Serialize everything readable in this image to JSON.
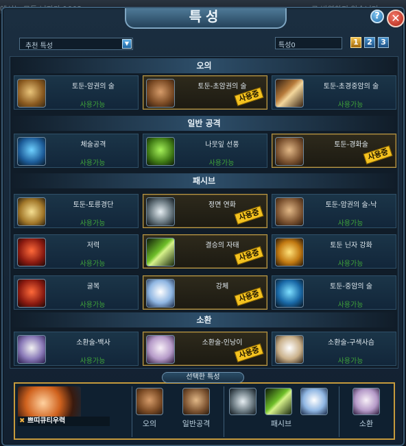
{
  "background": {
    "left_text": "에서는 모든 닌자가 1002",
    "right_text": "로 반영하지 않습니다"
  },
  "window": {
    "title": "특성",
    "help_label": "?",
    "close_label": "✕"
  },
  "filter": {
    "selected": "추천 특성",
    "arrow": "▼"
  },
  "points": {
    "label": "특성0"
  },
  "pages": [
    "1",
    "2",
    "3"
  ],
  "sections": [
    {
      "title": "오의",
      "cards": [
        {
          "name": "토둔-암권의 술",
          "status": "사용가능",
          "icon": "fist-icon",
          "selected": false
        },
        {
          "name": "토둔-초암권의 술",
          "status": "",
          "icon": "rock-fist-icon",
          "selected": true,
          "badge": "사용중"
        },
        {
          "name": "토둔-초경중암의 술",
          "status": "사용가능",
          "icon": "drill-icon",
          "selected": false
        }
      ]
    },
    {
      "title": "일반 공격",
      "cards": [
        {
          "name": "체술공격",
          "status": "사용가능",
          "icon": "punch-icon",
          "selected": false
        },
        {
          "name": "나뭇잎 선풍",
          "status": "사용가능",
          "icon": "whirlwind-icon",
          "selected": false
        },
        {
          "name": "토둔-경화술",
          "status": "",
          "icon": "earth-shield-icon",
          "selected": true,
          "badge": "사용중"
        }
      ]
    },
    {
      "title": "패시브",
      "cards": [
        {
          "name": "토둔-토릉경단",
          "status": "사용가능",
          "icon": "boulder-icon",
          "selected": false
        },
        {
          "name": "정면 연화",
          "status": "",
          "icon": "spiral-icon",
          "selected": true,
          "badge": "사용중"
        },
        {
          "name": "토둔-암권의 술-낙",
          "status": "사용가능",
          "icon": "rock-ball-icon",
          "selected": false
        },
        {
          "name": "저력",
          "status": "사용가능",
          "icon": "rage-icon",
          "selected": false
        },
        {
          "name": "결승의 자태",
          "status": "",
          "icon": "green-scroll-icon",
          "selected": true,
          "badge": "사용중"
        },
        {
          "name": "토둔 닌자 강화",
          "status": "사용가능",
          "icon": "earth-kanji-icon",
          "selected": false
        },
        {
          "name": "굴복",
          "status": "사용가능",
          "icon": "kneel-icon",
          "selected": false
        },
        {
          "name": "강체",
          "status": "",
          "icon": "ice-body-icon",
          "selected": true,
          "badge": "사용중"
        },
        {
          "name": "토둔-중암의 술",
          "status": "사용가능",
          "icon": "heavy-rock-icon",
          "selected": false
        }
      ]
    },
    {
      "title": "소환",
      "cards": [
        {
          "name": "소환술-백사",
          "status": "사용가능",
          "icon": "white-snake-icon",
          "selected": false
        },
        {
          "name": "소환술-인낭이",
          "status": "",
          "icon": "fox-icon",
          "selected": true,
          "badge": "사용중"
        },
        {
          "name": "소환술-구색사슴",
          "status": "사용가능",
          "icon": "deer-icon",
          "selected": false
        }
      ]
    }
  ],
  "selected_panel": {
    "title": "선택한 특성",
    "player_name": "쁘띠큐티우력",
    "groups": [
      {
        "label": "오의"
      },
      {
        "label": "일반공격"
      },
      {
        "label": "패시브"
      },
      {
        "label": "소환"
      }
    ]
  },
  "colors": {
    "available_green": "#3fa33a",
    "badge_yellow": "#f4c21f",
    "selected_border": "#bb9a48"
  }
}
